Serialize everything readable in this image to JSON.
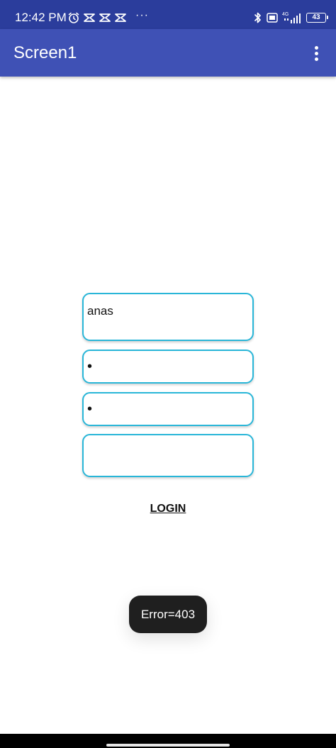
{
  "status_bar": {
    "time": "12:42 PM",
    "left_icons": [
      "alarm-icon",
      "notification-icon",
      "notification-icon",
      "notification-icon"
    ],
    "more_indicator": "···",
    "network_label": "4G",
    "battery_level": "43",
    "colors": {
      "background": "#2b3d9c"
    }
  },
  "app_bar": {
    "title": "Screen1",
    "menu_icon": "more-vertical-icon",
    "colors": {
      "background": "#3f51b5"
    }
  },
  "form": {
    "username_value": "anas",
    "password_value": "•",
    "confirm_value": "•",
    "extra_value": "",
    "login_label": "LOGIN",
    "colors": {
      "field_border": "#29b6d8"
    }
  },
  "toast": {
    "message": "Error=403"
  }
}
